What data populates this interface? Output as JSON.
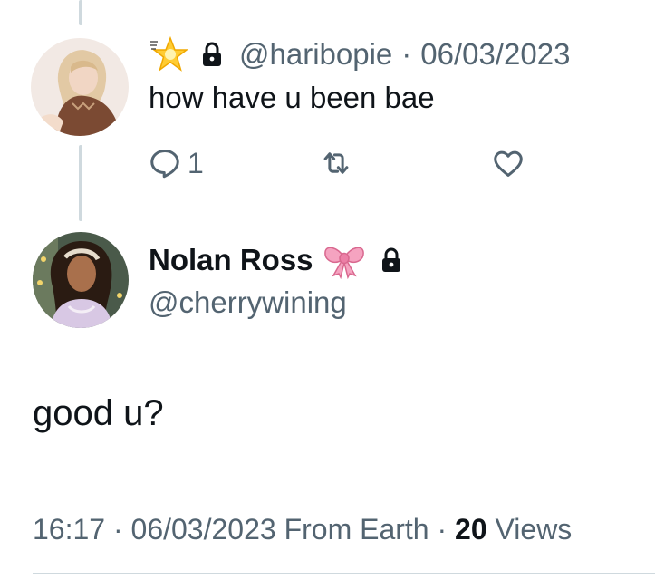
{
  "reply": {
    "handle": "@haribopie",
    "separator": "·",
    "date": "06/03/2023",
    "text": "how have u been bae",
    "reply_count": "1",
    "icons": [
      "star-emoji-icon",
      "lock-icon",
      "reply-icon",
      "retweet-icon",
      "like-icon"
    ]
  },
  "main": {
    "display_name": "Nolan Ross",
    "handle": "@cherrywining",
    "text": "good u?",
    "time": "16:17",
    "separator": "·",
    "date": "06/03/2023",
    "source": "From Earth",
    "views_count": "20",
    "views_label": "Views",
    "icons": [
      "bow-emoji-icon",
      "lock-icon"
    ]
  },
  "colors": {
    "text_primary": "#0f1419",
    "text_secondary": "#536471",
    "thread_line": "#cfd9de"
  }
}
